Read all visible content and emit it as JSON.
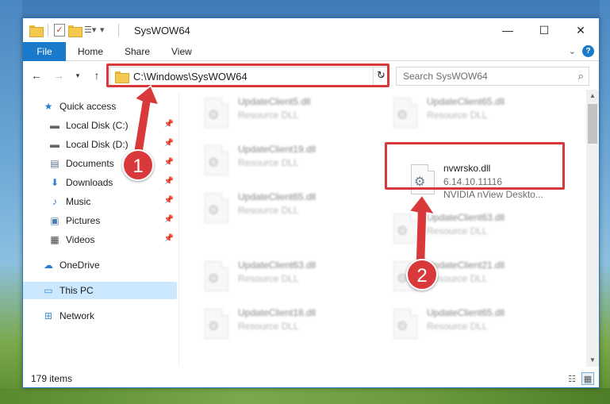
{
  "window": {
    "title": "SysWOW64",
    "controls": {
      "minimize": "—",
      "maximize": "☐",
      "close": "✕"
    }
  },
  "ribbon": {
    "tabs": [
      {
        "label": "File",
        "active": true
      },
      {
        "label": "Home"
      },
      {
        "label": "Share"
      },
      {
        "label": "View"
      }
    ],
    "help": "?"
  },
  "address": {
    "path": "C:\\Windows\\SysWOW64"
  },
  "search": {
    "placeholder": "Search SysWOW64"
  },
  "nav_pane": {
    "quick_access": "Quick access",
    "items": [
      {
        "label": "Local Disk (C:)",
        "icon": "drive-icon",
        "pinned": true
      },
      {
        "label": "Local Disk (D:)",
        "icon": "drive-icon",
        "pinned": true
      },
      {
        "label": "Documents",
        "icon": "documents-icon",
        "pinned": true
      },
      {
        "label": "Downloads",
        "icon": "downloads-icon",
        "pinned": true
      },
      {
        "label": "Music",
        "icon": "music-icon",
        "pinned": true
      },
      {
        "label": "Pictures",
        "icon": "pictures-icon",
        "pinned": true
      },
      {
        "label": "Videos",
        "icon": "videos-icon",
        "pinned": true
      }
    ],
    "onedrive": "OneDrive",
    "this_pc": "This PC",
    "network": "Network"
  },
  "files": [
    {
      "name": "UpdateClient5.dll",
      "desc": "Resource DLL"
    },
    {
      "name": "UpdateClient65.dll",
      "desc": "Resource DLL"
    },
    {
      "name": "UpdateClient19.dll",
      "desc": "Resource DLL"
    },
    {
      "name": "nvwrsko.dll",
      "version": "6.14.10.11116",
      "desc": "NVIDIA nView Deskto..."
    },
    {
      "name": "UpdateClient65.dll",
      "desc": "Resource DLL"
    },
    {
      "name": "UpdateClient63.dll",
      "desc": "Resource DLL"
    },
    {
      "name": "UpdateClient63.dll",
      "desc": "Resource DLL"
    },
    {
      "name": "UpdateClient21.dll",
      "desc": "Resource DLL"
    },
    {
      "name": "UpdateClient18.dll",
      "desc": "Resource DLL"
    },
    {
      "name": "UpdateClient65.dll",
      "desc": "Resource DLL"
    }
  ],
  "status": {
    "item_count": "179 items"
  },
  "annotations": {
    "step1": "1",
    "step2": "2",
    "color": "#d9393a"
  }
}
